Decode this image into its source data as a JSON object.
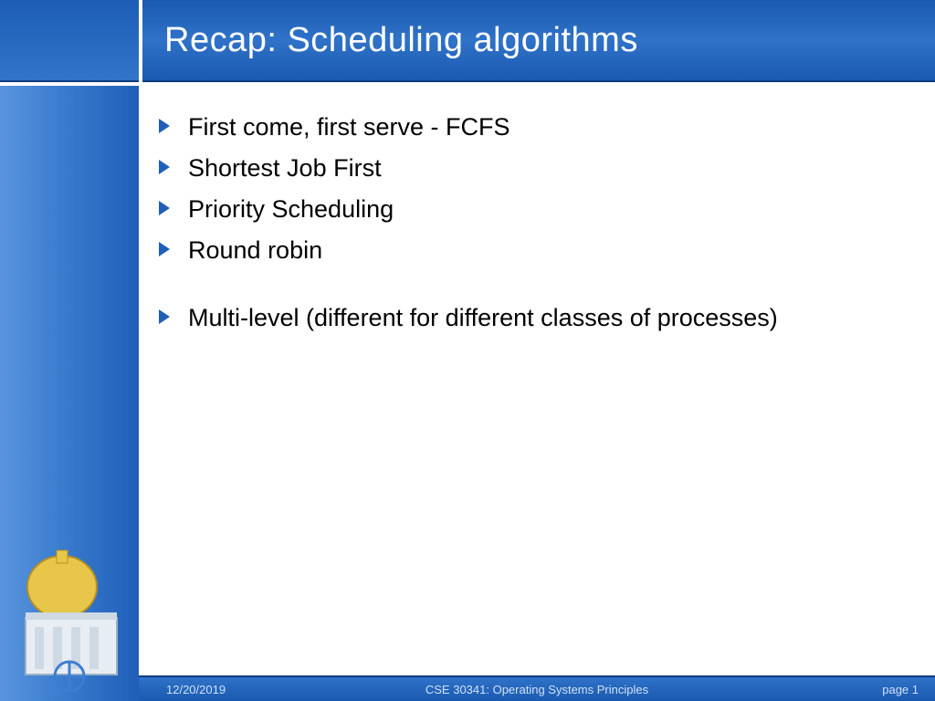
{
  "title": "Recap: Scheduling algorithms",
  "bullets": {
    "b0": "First come, first serve - FCFS",
    "b1": "Shortest Job First",
    "b2": "Priority Scheduling",
    "b3": "Round robin",
    "b4": "Multi-level (different for different classes of processes)"
  },
  "footer": {
    "date": "12/20/2019",
    "course": "CSE 30341: Operating Systems Principles",
    "page": "page 1"
  }
}
